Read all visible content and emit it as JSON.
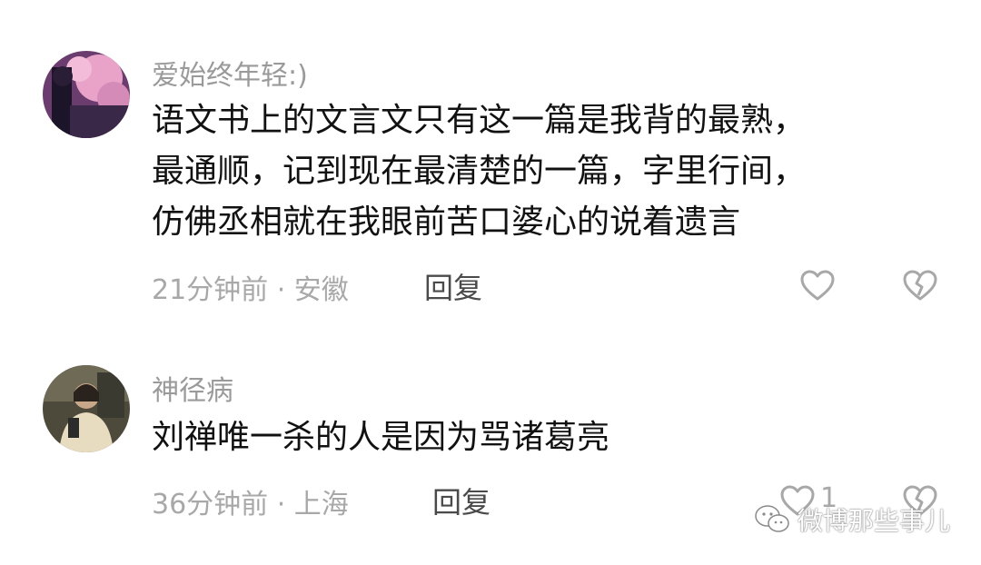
{
  "comments": [
    {
      "username": "爱始终年轻:)",
      "lines": [
        "语文书上的文言文只有这一篇是我背的最熟，",
        "最通顺，记到现在最清楚的一篇，字里行间，",
        "仿佛丞相就在我眼前苦口婆心的说着遗言"
      ],
      "time_location": "21分钟前 · 安徽",
      "reply_label": "回复",
      "like_count": ""
    },
    {
      "username": "神径病",
      "lines": [
        "刘禅唯一杀的人是因为骂诸葛亮"
      ],
      "time_location": "36分钟前 · 上海",
      "reply_label": "回复",
      "like_count": "1"
    }
  ],
  "watermark": {
    "text": "微博那些事儿",
    "icon": "wechat-icon"
  },
  "icons": {
    "like": "heart-icon",
    "dislike": "broken-heart-icon"
  }
}
